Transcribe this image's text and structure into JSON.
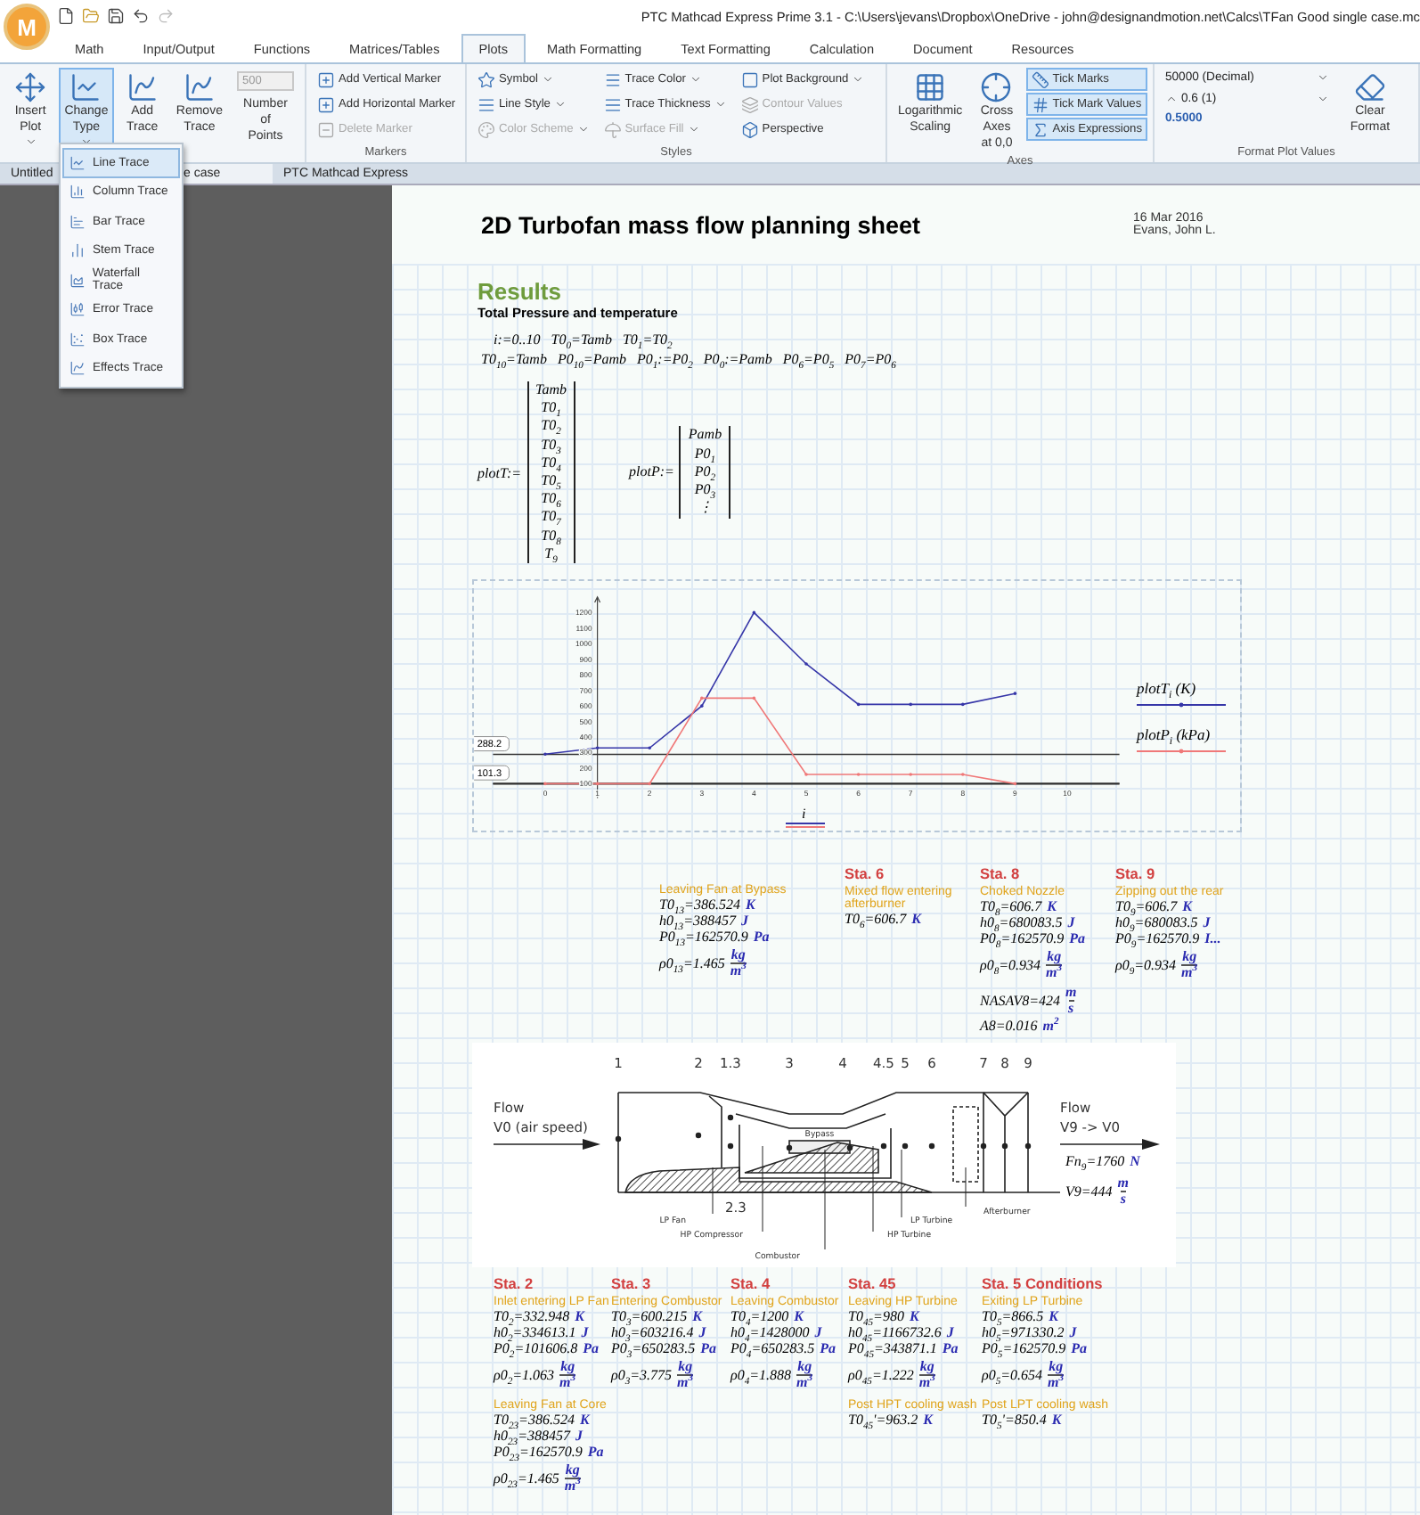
{
  "app": {
    "logo": "M",
    "title": "PTC Mathcad Express Prime 3.1 - C:\\Users\\jevans\\Dropbox\\OneDrive - john@designandmotion.net\\Calcs\\TFan Good single case.mc"
  },
  "ribbon": {
    "tabs": [
      {
        "label": "Math",
        "selected": false
      },
      {
        "label": "Input/Output",
        "selected": false
      },
      {
        "label": "Functions",
        "selected": false
      },
      {
        "label": "Matrices/Tables",
        "selected": false
      },
      {
        "label": "Plots",
        "selected": true
      },
      {
        "label": "Math Formatting",
        "selected": false
      },
      {
        "label": "Text Formatting",
        "selected": false
      },
      {
        "label": "Calculation",
        "selected": false
      },
      {
        "label": "Document",
        "selected": false
      },
      {
        "label": "Resources",
        "selected": false
      }
    ],
    "groups": [
      {
        "columns": [
          [
            {
              "kind": "large",
              "label": "Insert Plot",
              "menu": true,
              "pressed": false,
              "disabled": false
            }
          ],
          [
            {
              "kind": "large",
              "label": "Change Type",
              "menu": true,
              "pressed": true,
              "disabled": false
            }
          ],
          [
            {
              "kind": "large",
              "label": "Add Trace",
              "menu": false,
              "pressed": false,
              "disabled": false
            }
          ],
          [
            {
              "kind": "large",
              "label": "Remove Trace",
              "menu": false,
              "pressed": false,
              "disabled": false
            }
          ],
          [
            {
              "kind": "spin",
              "value": "500",
              "label": "Number of Points",
              "disabled": true
            }
          ]
        ]
      },
      {
        "label": "Markers",
        "columns": [
          [
            {
              "kind": "small",
              "label": "Add Vertical Marker",
              "menu": false,
              "disabled": false
            },
            {
              "kind": "small",
              "label": "Add Horizontal Marker",
              "menu": false,
              "disabled": false
            },
            {
              "kind": "small",
              "label": "Delete Marker",
              "menu": false,
              "disabled": true
            }
          ]
        ]
      },
      {
        "label": "Styles",
        "columns": [
          [
            {
              "kind": "small",
              "label": "Symbol",
              "menu": true,
              "disabled": false
            },
            {
              "kind": "small",
              "label": "Line Style",
              "menu": true,
              "disabled": false
            },
            {
              "kind": "small",
              "label": "Color Scheme",
              "menu": true,
              "disabled": true
            }
          ],
          [
            {
              "kind": "small",
              "label": "Trace Color",
              "menu": true,
              "disabled": false
            },
            {
              "kind": "small",
              "label": "Trace Thickness",
              "menu": true,
              "disabled": false
            },
            {
              "kind": "small",
              "label": "Surface Fill",
              "menu": true,
              "disabled": true
            }
          ],
          [
            {
              "kind": "small",
              "label": "Plot Background",
              "menu": true,
              "disabled": false
            },
            {
              "kind": "small",
              "label": "Contour Values",
              "menu": false,
              "disabled": true
            },
            {
              "kind": "small",
              "label": "Perspective",
              "menu": false,
              "disabled": false
            }
          ]
        ]
      },
      {
        "label": "Axes",
        "columns": [
          [
            {
              "kind": "large",
              "label": "Logarithmic Scaling",
              "menu": false,
              "pressed": false,
              "disabled": false
            }
          ],
          [
            {
              "kind": "large",
              "label": "Cross Axes at 0,0",
              "menu": false,
              "pressed": false,
              "disabled": false
            }
          ],
          [
            {
              "kind": "toggle",
              "label": "Tick Marks",
              "selected": true,
              "disabled": false
            },
            {
              "kind": "toggle",
              "label": "Tick Mark Values",
              "selected": true,
              "disabled": false
            },
            {
              "kind": "toggle",
              "label": "Axis Expressions",
              "selected": true,
              "disabled": false
            }
          ]
        ]
      },
      {
        "label": "Format Plot Values",
        "columns": [
          [
            {
              "kind": "select",
              "value": "50000 (Decimal)",
              "disabled": false
            },
            {
              "kind": "spinselect",
              "value": "0.6 (1)",
              "disabled": false
            },
            {
              "kind": "preview",
              "value": "0.5000",
              "disabled": false
            }
          ],
          [
            {
              "kind": "large",
              "label": "Clear Format",
              "menu": false,
              "pressed": false,
              "disabled": false
            }
          ]
        ]
      }
    ]
  },
  "doc_tabs": [
    {
      "label": "Untitled",
      "selected": false
    },
    {
      "label": "e case",
      "selected": true
    },
    {
      "label": "PTC Mathcad Express",
      "selected": false
    }
  ],
  "dropdown": [
    {
      "label": "Line Trace",
      "selected": true
    },
    {
      "label": "Column Trace",
      "selected": false
    },
    {
      "label": "Bar Trace",
      "selected": false
    },
    {
      "label": "Stem Trace",
      "selected": false
    },
    {
      "label": "Waterfall Trace",
      "selected": false
    },
    {
      "label": "Error Trace",
      "selected": false
    },
    {
      "label": "Box Trace",
      "selected": false
    },
    {
      "label": "Effects Trace",
      "selected": false
    }
  ],
  "page": {
    "title": "2D Turbofan mass flow planning sheet",
    "date": "16 Mar 2016",
    "author": "Evans, John L.",
    "heading": "Results",
    "subheading": "Total Pressure and temperature",
    "math_lines": [
      [
        "i:=0..10",
        "T0$_{0}$=Tamb",
        "T0$_{1}$=T0$_{2}$"
      ],
      [
        "T0$_{10}$=Tamb",
        "P0$_{10}$=Pamb",
        "P0$_{1}$:=P0$_{2}$",
        "P0$_{0}$:=Pamb",
        "P0$_{6}$=P0$_{5}$",
        "P0$_{7}$=P0$_{6}$"
      ]
    ],
    "matrices": [
      {
        "name": "plotT:=",
        "entries": [
          "Tamb",
          "T0$_{1}$",
          "T0$_{2}$",
          "T0$_{3}$",
          "T0$_{4}$",
          "T0$_{5}$",
          "T0$_{6}$",
          "T0$_{7}$",
          "T0$_{8}$",
          "T$_{9}$"
        ]
      },
      {
        "name": "plotP:=",
        "entries": [
          "Pamb",
          "P0$_{1}$",
          "P0$_{2}$",
          "P0$_{3}$",
          "⋮"
        ]
      }
    ],
    "chart_data": {
      "type": "line",
      "xlabel": "i",
      "x": [
        0,
        1,
        2,
        3,
        4,
        5,
        6,
        7,
        8,
        9
      ],
      "xlim": [
        -1,
        11
      ],
      "ylim": [
        100,
        1300
      ],
      "xticks": [
        0,
        1,
        2,
        3,
        4,
        5,
        6,
        7,
        8,
        9,
        10
      ],
      "yticks": [
        100,
        200,
        300,
        400,
        500,
        600,
        700,
        800,
        900,
        1000,
        1100,
        1200
      ],
      "series": [
        {
          "name": "plotT$_{i}$ (K)",
          "color": "#3636a8",
          "values": [
            290,
            330,
            330,
            600,
            1200,
            870,
            610,
            610,
            610,
            680
          ]
        },
        {
          "name": "plotP$_{i}$ (kPa)",
          "color": "#f07878",
          "values": [
            100,
            100,
            100,
            650,
            650,
            160,
            160,
            160,
            160,
            100
          ]
        }
      ],
      "ref_lines": [
        {
          "label": "288.2"
        },
        {
          "label": "101.3"
        }
      ]
    },
    "stations_top": [
      {
        "blocks": [
          {
            "subtitle": "Leaving Fan at Bypass",
            "lines": [
              {
                "kind": "value",
                "expr": "T0$_{13}$=386.524",
                "unit": "K"
              },
              {
                "kind": "value",
                "expr": "h0$_{13}$=388457",
                "unit": "J"
              },
              {
                "kind": "value",
                "expr": "P0$_{13}$=162570.9",
                "unit": "Pa"
              },
              {
                "kind": "fraction",
                "expr": "ρ0$_{13}$=1.465",
                "unit": "kg",
                "per": "m$^{3}$"
              }
            ]
          }
        ]
      },
      {
        "title": "Sta. 6",
        "blocks": [
          {
            "subtitle": "Mixed flow entering afterburner",
            "lines": [
              {
                "kind": "value",
                "expr": "T0$_{6}$=606.7",
                "unit": "K"
              }
            ]
          }
        ]
      },
      {
        "title": "Sta. 8",
        "blocks": [
          {
            "subtitle": "Choked Nozzle",
            "lines": [
              {
                "kind": "value",
                "expr": "T0$_{8}$=606.7",
                "unit": "K"
              },
              {
                "kind": "value",
                "expr": "h0$_{8}$=680083.5",
                "unit": "J"
              },
              {
                "kind": "value",
                "expr": "P0$_{8}$=162570.9",
                "unit": "Pa"
              },
              {
                "kind": "fraction",
                "expr": "ρ0$_{8}$=0.934",
                "unit": "kg",
                "per": "m$^{3}$"
              },
              {
                "kind": "fraction",
                "expr": "NASAV8=424",
                "unit": "m",
                "per": "s"
              },
              {
                "kind": "value",
                "expr": "A8=0.016",
                "unit": "m$^{2}$"
              }
            ]
          }
        ]
      },
      {
        "title": "Sta. 9",
        "blocks": [
          {
            "subtitle": "Zipping out the rear",
            "lines": [
              {
                "kind": "value",
                "expr": "T0$_{9}$=606.7",
                "unit": "K"
              },
              {
                "kind": "value",
                "expr": "h0$_{9}$=680083.5",
                "unit": "J"
              },
              {
                "kind": "value",
                "expr": "P0$_{9}$=162570.9",
                "unit": "I..."
              },
              {
                "kind": "fraction",
                "expr": "ρ0$_{9}$=0.934",
                "unit": "kg",
                "per": "m$^{3}$"
              }
            ]
          }
        ]
      }
    ],
    "diagram": {
      "labels": [
        {
          "text": "1",
          "kind": "station"
        },
        {
          "text": "2",
          "kind": "station"
        },
        {
          "text": "1.3",
          "kind": "station"
        },
        {
          "text": "3",
          "kind": "station"
        },
        {
          "text": "4",
          "kind": "station"
        },
        {
          "text": "4.5",
          "kind": "station"
        },
        {
          "text": "5",
          "kind": "station"
        },
        {
          "text": "6",
          "kind": "station"
        },
        {
          "text": "7",
          "kind": "station"
        },
        {
          "text": "8",
          "kind": "station"
        },
        {
          "text": "9",
          "kind": "station"
        },
        {
          "text": "Flow",
          "kind": "flow"
        },
        {
          "text": "Flow",
          "kind": "flow"
        },
        {
          "text": "V0 (air speed)",
          "kind": "flow"
        },
        {
          "text": "Bypass",
          "kind": "part"
        },
        {
          "text": "V9 -> V0",
          "kind": "flow"
        },
        {
          "text": "2.3",
          "kind": "station"
        },
        {
          "text": "Afterburner",
          "kind": "part"
        },
        {
          "text": "LP Fan",
          "kind": "part"
        },
        {
          "text": "LP Turbine",
          "kind": "part"
        },
        {
          "text": "HP Compressor",
          "kind": "part"
        },
        {
          "text": "HP Turbine",
          "kind": "part"
        },
        {
          "text": "Combustor",
          "kind": "part"
        }
      ],
      "results": [
        {
          "kind": "value",
          "expr": "Fn$_{9}$=1760",
          "unit": "N"
        },
        {
          "kind": "fraction",
          "expr": "V9=444",
          "unit": "m",
          "per": "s"
        }
      ]
    },
    "stations_bottom": [
      {
        "title": "Sta. 2",
        "blocks": [
          {
            "subtitle": "Inlet entering LP Fan",
            "lines": [
              {
                "kind": "value",
                "expr": "T0$_{2}$=332.948",
                "unit": "K"
              },
              {
                "kind": "value",
                "expr": "h0$_{2}$=334613.1",
                "unit": "J"
              },
              {
                "kind": "value",
                "expr": "P0$_{2}$=101606.8",
                "unit": "Pa"
              },
              {
                "kind": "fraction",
                "expr": "ρ0$_{2}$=1.063",
                "unit": "kg",
                "per": "m$^{3}$"
              }
            ]
          },
          {
            "subtitle": "Leaving Fan at Core",
            "lines": [
              {
                "kind": "value",
                "expr": "T0$_{23}$=386.524",
                "unit": "K"
              },
              {
                "kind": "value",
                "expr": "h0$_{23}$=388457",
                "unit": "J"
              },
              {
                "kind": "value",
                "expr": "P0$_{23}$=162570.9",
                "unit": "Pa"
              },
              {
                "kind": "fraction",
                "expr": "ρ0$_{23}$=1.465",
                "unit": "kg",
                "per": "m$^{3}$"
              }
            ]
          }
        ]
      },
      {
        "title": "Sta. 3",
        "blocks": [
          {
            "subtitle": "Entering Combustor",
            "lines": [
              {
                "kind": "value",
                "expr": "T0$_{3}$=600.215",
                "unit": "K"
              },
              {
                "kind": "value",
                "expr": "h0$_{3}$=603216.4",
                "unit": "J"
              },
              {
                "kind": "value",
                "expr": "P0$_{3}$=650283.5",
                "unit": "Pa"
              },
              {
                "kind": "fraction",
                "expr": "ρ0$_{3}$=3.775",
                "unit": "kg",
                "per": "m$^{3}$"
              }
            ]
          }
        ]
      },
      {
        "title": "Sta. 4",
        "blocks": [
          {
            "subtitle": "Leaving Combustor",
            "lines": [
              {
                "kind": "value",
                "expr": "T0$_{4}$=1200",
                "unit": "K"
              },
              {
                "kind": "value",
                "expr": "h0$_{4}$=1428000",
                "unit": "J"
              },
              {
                "kind": "value",
                "expr": "P0$_{4}$=650283.5",
                "unit": "Pa"
              },
              {
                "kind": "fraction",
                "expr": "ρ0$_{4}$=1.888",
                "unit": "kg",
                "per": "m$^{3}$"
              }
            ]
          }
        ]
      },
      {
        "title": "Sta. 45",
        "blocks": [
          {
            "subtitle": "Leaving HP Turbine",
            "lines": [
              {
                "kind": "value",
                "expr": "T0$_{45}$=980",
                "unit": "K"
              },
              {
                "kind": "value",
                "expr": "h0$_{45}$=1166732.6",
                "unit": "J"
              },
              {
                "kind": "value",
                "expr": "P0$_{45}$=343871.1",
                "unit": "Pa"
              },
              {
                "kind": "fraction",
                "expr": "ρ0$_{45}$=1.222",
                "unit": "kg",
                "per": "m$^{3}$"
              }
            ]
          },
          {
            "subtitle": "Post HPT cooling wash",
            "lines": [
              {
                "kind": "value",
                "expr": "T0$_{45}$'=963.2",
                "unit": "K"
              }
            ]
          }
        ]
      },
      {
        "title": "Sta. 5 Conditions",
        "blocks": [
          {
            "subtitle": "Exiting LP Turbine",
            "lines": [
              {
                "kind": "value",
                "expr": "T0$_{5}$=866.5",
                "unit": "K"
              },
              {
                "kind": "value",
                "expr": "h0$_{5}$=971330.2",
                "unit": "J"
              },
              {
                "kind": "value",
                "expr": "P0$_{5}$=162570.9",
                "unit": "Pa"
              },
              {
                "kind": "fraction",
                "expr": "ρ0$_{5}$=0.654",
                "unit": "kg",
                "per": "m$^{3}$"
              }
            ]
          },
          {
            "subtitle": "Post LPT cooling wash",
            "lines": [
              {
                "kind": "value",
                "expr": "T0$_{5}$'=850.4",
                "unit": "K"
              }
            ]
          }
        ]
      }
    ]
  }
}
